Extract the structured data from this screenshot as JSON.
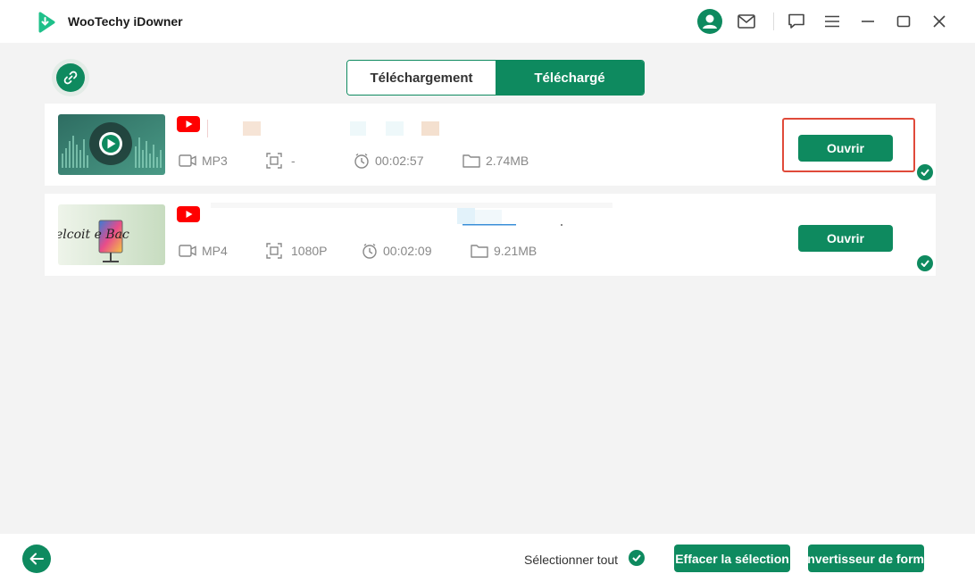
{
  "app": {
    "title": "WooTechy iDowner"
  },
  "tabs": [
    {
      "label": "Téléchargement",
      "active": false
    },
    {
      "label": "Téléchargé",
      "active": true
    }
  ],
  "items": [
    {
      "source_icon": "youtube-icon",
      "format": "MP3",
      "resolution": "-",
      "duration": "00:02:57",
      "size": "2.74MB",
      "open_label": "Ouvrir",
      "highlighted": true
    },
    {
      "source_icon": "youtube-icon",
      "format": "MP4",
      "resolution": "1080P",
      "duration": "00:02:09",
      "size": "9.21MB",
      "open_label": "Ouvrir",
      "thumbnail_text": "elcoit e Bac"
    }
  ],
  "footer": {
    "select_all_label": "Sélectionner tout",
    "clear_label": "Effacer la sélection",
    "convert_label": "onvertisseur de form"
  },
  "colors": {
    "accent": "#0e8a5f",
    "highlight": "#e04a3a",
    "youtube": "#ff0000"
  }
}
